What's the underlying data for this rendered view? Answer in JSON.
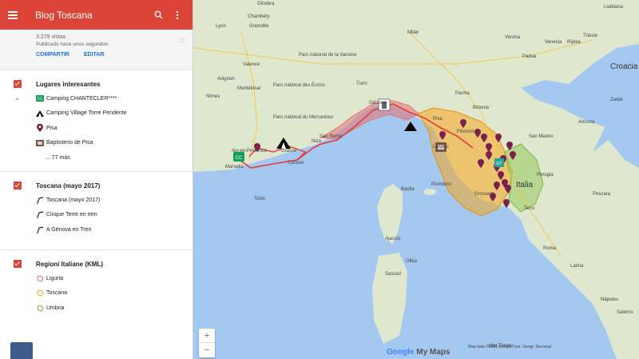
{
  "app": {
    "title": "Blog Toscana",
    "views": "3.279 vistas",
    "published": "Publicado hace unos segundos",
    "share": "COMPARTIR",
    "edit": "EDITAR"
  },
  "layers": [
    {
      "title": "Lugares interesantes",
      "items": [
        {
          "label": "Camping CHANTECLER****",
          "icon": "campground-cc-icon",
          "color": "#0f9d58"
        },
        {
          "label": "Camping Village Torre Pendente",
          "icon": "tent-icon",
          "color": "#000000"
        },
        {
          "label": "Pisa",
          "icon": "map-pin-icon",
          "color": "#7b1f4b"
        },
        {
          "label": "Baptisterio de Pisa",
          "icon": "monument-icon",
          "color": "#795548"
        }
      ],
      "more": "... 77 más"
    },
    {
      "title": "Toscana (mayo 2017)",
      "items": [
        {
          "label": "Toscana (mayo 2017)",
          "icon": "route-icon",
          "color": "#202124"
        },
        {
          "label": "Cinque Terre en tren",
          "icon": "route-icon",
          "color": "#202124"
        },
        {
          "label": "A Génova en Tren",
          "icon": "route-icon",
          "color": "#202124"
        }
      ]
    },
    {
      "title": "Regioni Italiane (KML)",
      "items": [
        {
          "label": "Liguria",
          "icon": "polygon-icon",
          "color": "#e57373"
        },
        {
          "label": "Toscana",
          "icon": "polygon-icon",
          "color": "#f5a623"
        },
        {
          "label": "Umbria",
          "icon": "polygon-icon",
          "color": "#7cb342"
        }
      ]
    }
  ],
  "map_labels": [
    {
      "text": "Ginebra"
    },
    {
      "text": "Lyon"
    },
    {
      "text": "Grenoble"
    },
    {
      "text": "Chambéry"
    },
    {
      "text": "Valence"
    },
    {
      "text": "Montélimar"
    },
    {
      "text": "Avignon"
    },
    {
      "text": "Nîmes"
    },
    {
      "text": "Aix-en-Provence"
    },
    {
      "text": "Marsella"
    },
    {
      "text": "Tolón"
    },
    {
      "text": "Cannes"
    },
    {
      "text": "Niza"
    },
    {
      "text": "Grasse"
    },
    {
      "text": "San Remo"
    },
    {
      "text": "Parc national du Mercantour"
    },
    {
      "text": "Parc national des Écrins"
    },
    {
      "text": "Parc national de la Vanoise"
    },
    {
      "text": "Turín"
    },
    {
      "text": "Milán"
    },
    {
      "text": "Génova"
    },
    {
      "text": "Parma"
    },
    {
      "text": "Bolonia"
    },
    {
      "text": "Venecia"
    },
    {
      "text": "Verona"
    },
    {
      "text": "Padua"
    },
    {
      "text": "Trieste"
    },
    {
      "text": "Liubliana"
    },
    {
      "text": "Croacia"
    },
    {
      "text": "Rijeka"
    },
    {
      "text": "Zadar"
    },
    {
      "text": "San Marino"
    },
    {
      "text": "Florencia"
    },
    {
      "text": "Livorno"
    },
    {
      "text": "Pisa"
    },
    {
      "text": "Grosseto"
    },
    {
      "text": "Italia"
    },
    {
      "text": "Perugia"
    },
    {
      "text": "Terni"
    },
    {
      "text": "Piombino"
    },
    {
      "text": "Ancona"
    },
    {
      "text": "Pescara"
    },
    {
      "text": "Roma"
    },
    {
      "text": "Latina"
    },
    {
      "text": "Nápoles"
    },
    {
      "text": "Salerno"
    },
    {
      "text": "Bastia"
    },
    {
      "text": "Ajaccio"
    },
    {
      "text": "Olbia"
    },
    {
      "text": "Sassari"
    },
    {
      "text": "Mar Tirreno"
    }
  ],
  "map_colors": {
    "sea": "#a4c8f0",
    "land": "#dfe8cf",
    "liguria": "#e57373",
    "toscana": "#f5a623",
    "umbria": "#9ccc65",
    "route": "#e53935",
    "pin": "#7b1f4b"
  },
  "footer": {
    "brand_google": "Google",
    "brand_maps": "My Maps",
    "terms": "Map data ©2021 Google, Inst. Geogr. Nacional"
  }
}
